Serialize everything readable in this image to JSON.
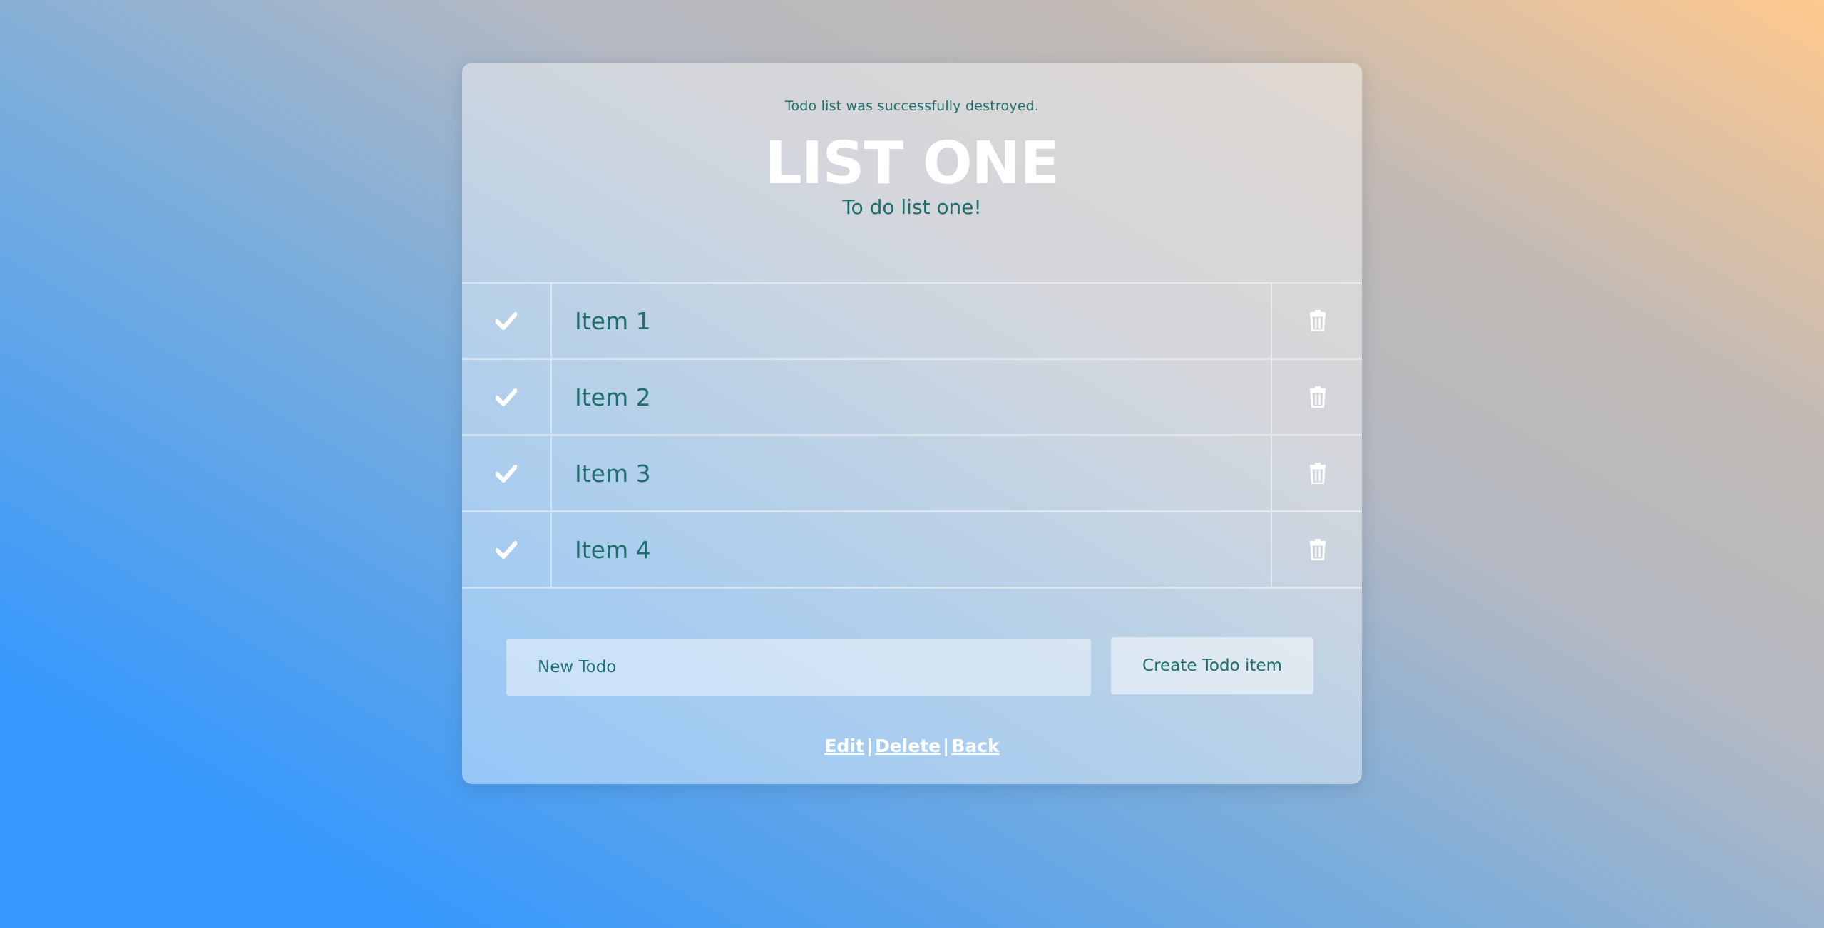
{
  "flash_notice": "Todo list was successfully destroyed.",
  "list": {
    "title": "LIST ONE",
    "description": "To do list one!"
  },
  "items": [
    {
      "text": "Item 1"
    },
    {
      "text": "Item 2"
    },
    {
      "text": "Item 3"
    },
    {
      "text": "Item 4"
    }
  ],
  "form": {
    "new_todo_placeholder": "New Todo",
    "new_todo_value": "",
    "submit_label": "Create Todo item"
  },
  "footer": {
    "edit": "Edit",
    "delete": "Delete",
    "back": "Back",
    "separator": "|"
  },
  "icons": {
    "complete": "check-icon",
    "delete": "trash-icon"
  },
  "colors": {
    "text_teal": "#1f6f6c",
    "white": "#ffffff",
    "gradient_blue": "#3598fd",
    "gradient_peach": "#ffc98e"
  }
}
